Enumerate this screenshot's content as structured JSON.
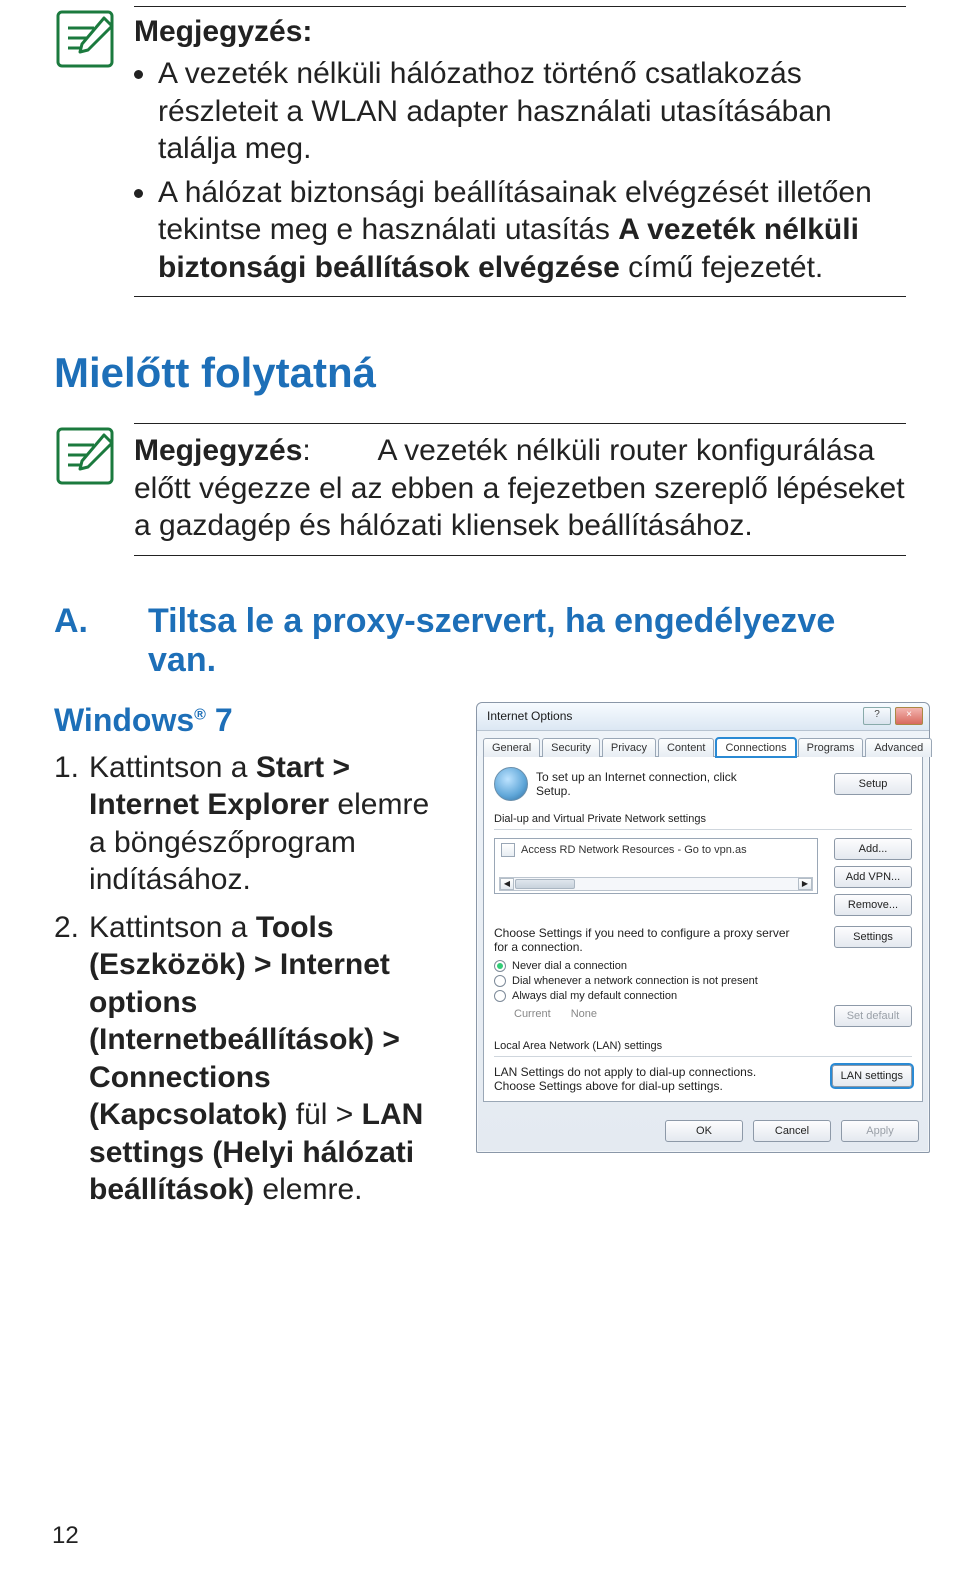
{
  "note1": {
    "title": "Megjegyzés:",
    "items": [
      {
        "pre": "A vezeték nélküli hálózathoz történő csatlakozás részleteit a WLAN adapter használati utasításában találja meg."
      },
      {
        "pre": "A hálózat biztonsági beállításainak elvégzését illetően tekintse meg e használati utasítás ",
        "bold": "A vezeték nélküli biztonsági beállítások elvégzése",
        "post": " című fejezetét."
      }
    ]
  },
  "h1": "Mielőtt folytatná",
  "note2": {
    "title": "Megjegyzés",
    "colon": ":",
    "body": "A vezeték nélküli router konfigurálása előtt végezze el az ebben a fejezetben szereplő lépéseket a gazdagép és hálózati kliensek beállításához."
  },
  "sectA": {
    "label": "A.",
    "title": "Tiltsa le a proxy-szervert, ha engedélyezve van."
  },
  "os": {
    "name": "Windows",
    "sup": "®",
    "ver": "7"
  },
  "steps": [
    {
      "num": "1.",
      "parts": [
        "Kattintson a ",
        {
          "b": "Start > Internet Explorer"
        },
        " elemre a böngészőprogram indításához."
      ]
    },
    {
      "num": "2.",
      "parts": [
        "Kattintson a ",
        {
          "b": "Tools (Eszközök) > Internet options (Internetbeállítások) > Connections (Kapcsolatok)"
        },
        " fül > ",
        {
          "b": "LAN settings (Helyi hálózati beállítások)"
        },
        " elemre."
      ]
    }
  ],
  "dlg": {
    "title": "Internet Options",
    "help": "?",
    "close": "×",
    "tabs": [
      "General",
      "Security",
      "Privacy",
      "Content",
      "Connections",
      "Programs",
      "Advanced"
    ],
    "activeTab": 4,
    "setupText": "To set up an Internet connection, click Setup.",
    "setupBtn": "Setup",
    "dialGroup": "Dial-up and Virtual Private Network settings",
    "vpnItem": "Access RD Network Resources - Go to vpn.as",
    "addBtn": "Add...",
    "addVpnBtn": "Add VPN...",
    "removeBtn": "Remove...",
    "chooseText": "Choose Settings if you need to configure a proxy server for a connection.",
    "settingsBtn": "Settings",
    "radios": [
      {
        "label": "Never dial a connection",
        "sel": true
      },
      {
        "label": "Dial whenever a network connection is not present",
        "sel": false
      },
      {
        "label": "Always dial my default connection",
        "sel": false
      }
    ],
    "currentLabel": "Current",
    "currentValue": "None",
    "setDefaultBtn": "Set default",
    "lanGroup": "Local Area Network (LAN) settings",
    "lanText": "LAN Settings do not apply to dial-up connections. Choose Settings above for dial-up settings.",
    "lanBtn": "LAN settings",
    "ok": "OK",
    "cancel": "Cancel",
    "apply": "Apply"
  },
  "pageNum": "12"
}
